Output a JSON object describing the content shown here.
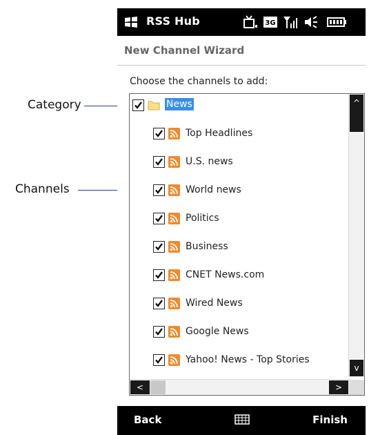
{
  "annotations": {
    "category_label": "Category",
    "channels_label": "Channels"
  },
  "titlebar": {
    "app_title": "RSS Hub",
    "status_icons": [
      "windows-logo-icon",
      "tv-icon",
      "3g-icon",
      "signal-icon",
      "volume-icon",
      "battery-icon"
    ]
  },
  "subtitle": "New Channel Wizard",
  "instruction": "Choose the channels to add:",
  "tree": {
    "category": {
      "label": "News",
      "checked": true,
      "selected": true
    },
    "channels": [
      {
        "label": "Top Headlines",
        "checked": true
      },
      {
        "label": "U.S. news",
        "checked": true
      },
      {
        "label": "World news",
        "checked": true
      },
      {
        "label": "Politics",
        "checked": true
      },
      {
        "label": "Business",
        "checked": true
      },
      {
        "label": "CNET News.com",
        "checked": true
      },
      {
        "label": "Wired News",
        "checked": true
      },
      {
        "label": "Google News",
        "checked": true
      },
      {
        "label": "Yahoo! News - Top Stories",
        "checked": true
      }
    ]
  },
  "softkeys": {
    "left": "Back",
    "right": "Finish"
  },
  "colors": {
    "selection": "#3a8ee6",
    "rss": "#f08a2b",
    "annotation_line": "#1f3f8f"
  }
}
